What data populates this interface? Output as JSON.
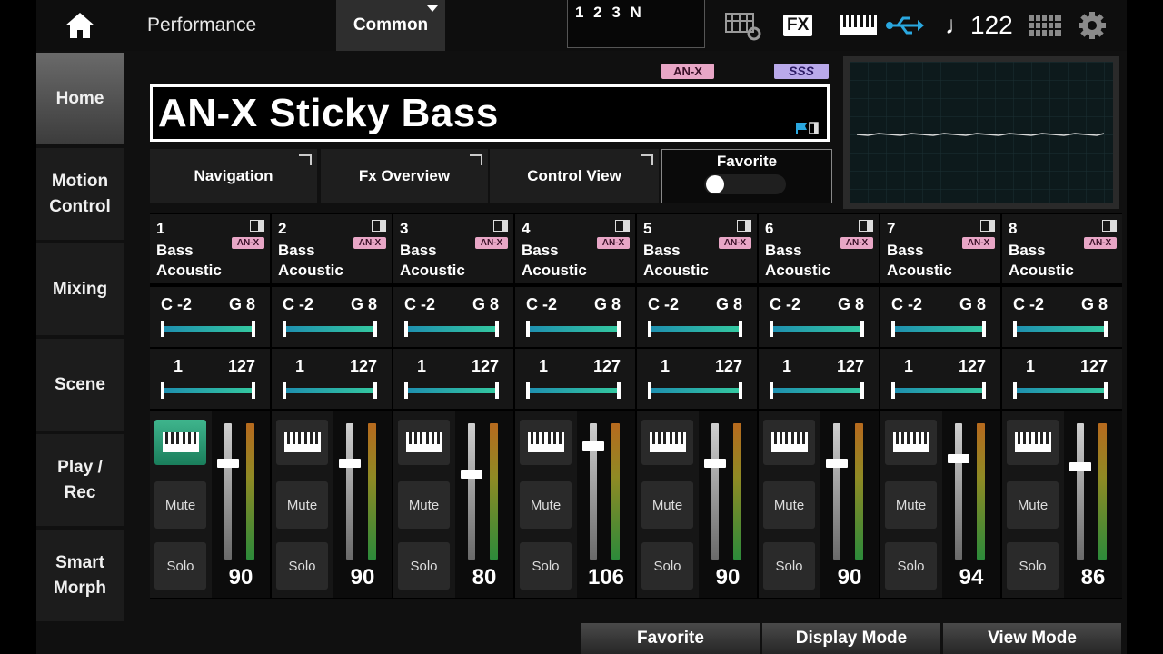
{
  "header": {
    "breadcrumb": "Performance",
    "common_tab": "Common",
    "part_indicator": "1 2 3 N",
    "fx_label": "FX",
    "tempo": "♩122"
  },
  "sidebar": {
    "items": [
      {
        "label": "Home",
        "active": true
      },
      {
        "label": "Motion Control",
        "active": false
      },
      {
        "label": "Mixing",
        "active": false
      },
      {
        "label": "Scene",
        "active": false
      },
      {
        "label": "Play / Rec",
        "active": false
      },
      {
        "label": "Smart Morph",
        "active": false
      }
    ]
  },
  "performance": {
    "engine_badge": "AN-X",
    "sss_badge": "SSS",
    "name": "AN-X Sticky Bass"
  },
  "buttons": {
    "navigation": "Navigation",
    "fx_overview": "Fx Overview",
    "control_view": "Control View",
    "favorite": "Favorite"
  },
  "favorite_toggle_on": false,
  "parts": [
    {
      "num": "1",
      "cat1": "Bass",
      "cat2": "Acoustic",
      "badge": "AN-X",
      "note_lo": "C -2",
      "note_hi": "G 8",
      "vel_lo": "1",
      "vel_hi": "127",
      "kbd_on": true,
      "mute": "Mute",
      "solo": "Solo",
      "volume": "90",
      "volume_value": 90
    },
    {
      "num": "2",
      "cat1": "Bass",
      "cat2": "Acoustic",
      "badge": "AN-X",
      "note_lo": "C -2",
      "note_hi": "G 8",
      "vel_lo": "1",
      "vel_hi": "127",
      "kbd_on": false,
      "mute": "Mute",
      "solo": "Solo",
      "volume": "90",
      "volume_value": 90
    },
    {
      "num": "3",
      "cat1": "Bass",
      "cat2": "Acoustic",
      "badge": "AN-X",
      "note_lo": "C -2",
      "note_hi": "G 8",
      "vel_lo": "1",
      "vel_hi": "127",
      "kbd_on": false,
      "mute": "Mute",
      "solo": "Solo",
      "volume": "80",
      "volume_value": 80
    },
    {
      "num": "4",
      "cat1": "Bass",
      "cat2": "Acoustic",
      "badge": "AN-X",
      "note_lo": "C -2",
      "note_hi": "G 8",
      "vel_lo": "1",
      "vel_hi": "127",
      "kbd_on": false,
      "mute": "Mute",
      "solo": "Solo",
      "volume": "106",
      "volume_value": 106
    },
    {
      "num": "5",
      "cat1": "Bass",
      "cat2": "Acoustic",
      "badge": "AN-X",
      "note_lo": "C -2",
      "note_hi": "G 8",
      "vel_lo": "1",
      "vel_hi": "127",
      "kbd_on": false,
      "mute": "Mute",
      "solo": "Solo",
      "volume": "90",
      "volume_value": 90
    },
    {
      "num": "6",
      "cat1": "Bass",
      "cat2": "Acoustic",
      "badge": "AN-X",
      "note_lo": "C -2",
      "note_hi": "G 8",
      "vel_lo": "1",
      "vel_hi": "127",
      "kbd_on": false,
      "mute": "Mute",
      "solo": "Solo",
      "volume": "90",
      "volume_value": 90
    },
    {
      "num": "7",
      "cat1": "Bass",
      "cat2": "Acoustic",
      "badge": "AN-X",
      "note_lo": "C -2",
      "note_hi": "G 8",
      "vel_lo": "1",
      "vel_hi": "127",
      "kbd_on": false,
      "mute": "Mute",
      "solo": "Solo",
      "volume": "94",
      "volume_value": 94
    },
    {
      "num": "8",
      "cat1": "Bass",
      "cat2": "Acoustic",
      "badge": "AN-X",
      "note_lo": "C -2",
      "note_hi": "G 8",
      "vel_lo": "1",
      "vel_hi": "127",
      "kbd_on": false,
      "mute": "Mute",
      "solo": "Solo",
      "volume": "86",
      "volume_value": 86
    }
  ],
  "function_buttons": {
    "f1": "Favorite",
    "f2": "Display Mode",
    "f3": "View Mode"
  },
  "colors": {
    "accent_green": "#2fa67d",
    "anx_badge": "#e8a6c6",
    "sss_badge": "#b9a9ea",
    "range_bar": "#1e8fb0"
  },
  "icons": [
    "home-icon",
    "arpeggio-settings-icon",
    "fx-icon",
    "keyboard-icon",
    "usb-icon",
    "grid-icon",
    "gear-icon"
  ]
}
